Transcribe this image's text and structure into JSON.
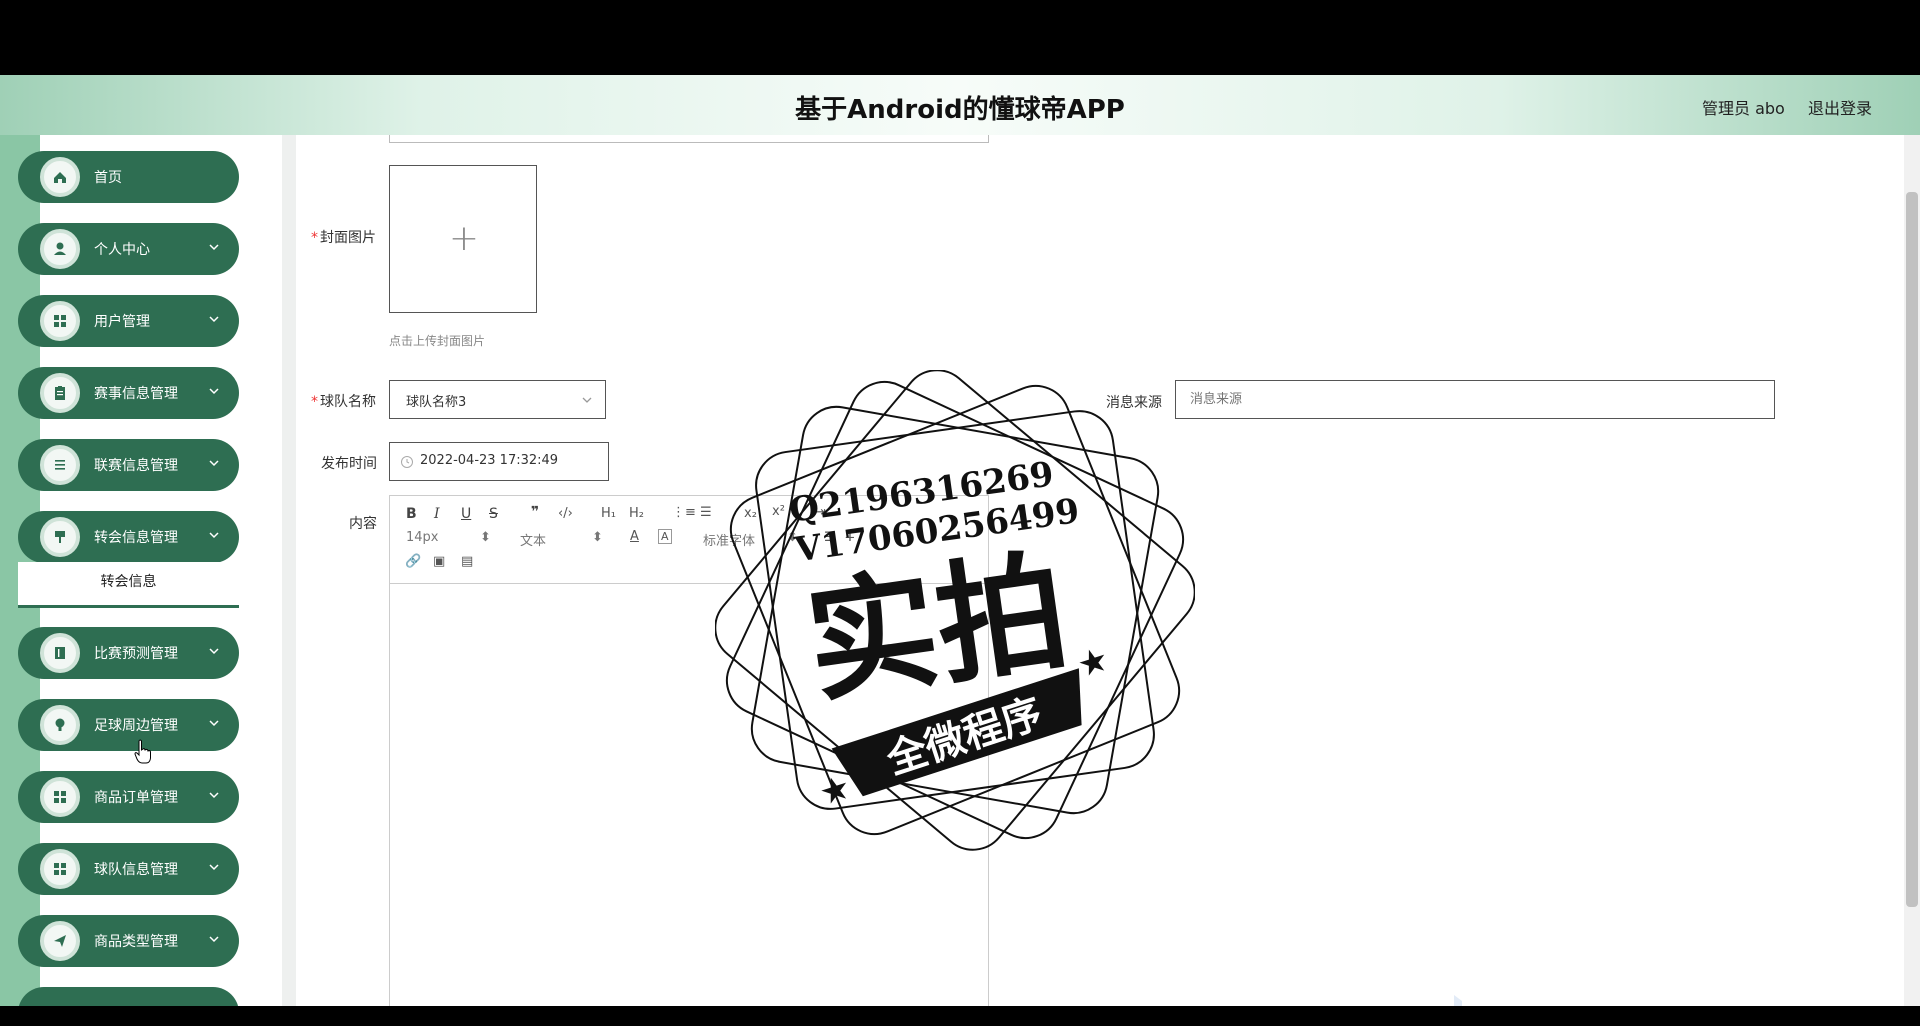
{
  "header": {
    "title": "基于Android的懂球帝APP",
    "user_label": "管理员 abo",
    "logout_label": "退出登录"
  },
  "sidebar": {
    "items": [
      {
        "label": "首页",
        "icon": "home-icon",
        "has_chevron": false
      },
      {
        "label": "个人中心",
        "icon": "user-icon",
        "has_chevron": true
      },
      {
        "label": "用户管理",
        "icon": "grid-icon",
        "has_chevron": true
      },
      {
        "label": "赛事信息管理",
        "icon": "clipboard-icon",
        "has_chevron": true
      },
      {
        "label": "联赛信息管理",
        "icon": "list-icon",
        "has_chevron": true
      },
      {
        "label": "转会信息管理",
        "icon": "brush-icon",
        "has_chevron": true
      },
      {
        "label": "比赛预测管理",
        "icon": "book-icon",
        "has_chevron": true
      },
      {
        "label": "足球周边管理",
        "icon": "bulb-icon",
        "has_chevron": true
      },
      {
        "label": "商品订单管理",
        "icon": "grid-icon",
        "has_chevron": true
      },
      {
        "label": "球队信息管理",
        "icon": "grid-icon",
        "has_chevron": true
      },
      {
        "label": "商品类型管理",
        "icon": "send-icon",
        "has_chevron": true
      }
    ],
    "submenu_label": "转会信息"
  },
  "form": {
    "cover_label": "封面图片",
    "cover_hint": "点击上传封面图片",
    "team_label": "球队名称",
    "team_value": "球队名称3",
    "source_label": "消息来源",
    "source_placeholder": "消息来源",
    "time_label": "发布时间",
    "time_value": "2022-04-23 17:32:49",
    "content_label": "内容"
  },
  "editor": {
    "font_size": "14px",
    "block_type": "文本",
    "font_family": "标准字体",
    "buttons": [
      "B",
      "I",
      "U",
      "S",
      "quote",
      "code",
      "H1",
      "H2",
      "ordered-list",
      "bullet-list",
      "subscript",
      "superscript",
      "indent",
      "color",
      "background",
      "align",
      "clean",
      "link",
      "image",
      "video"
    ]
  },
  "watermark": {
    "line1": "Q2196316269",
    "line2": "V17060256499",
    "big_text": "实拍",
    "banner": "全微程序"
  },
  "colors": {
    "menu_green": "#2e6e52",
    "rail_green": "#8ac6a5"
  }
}
